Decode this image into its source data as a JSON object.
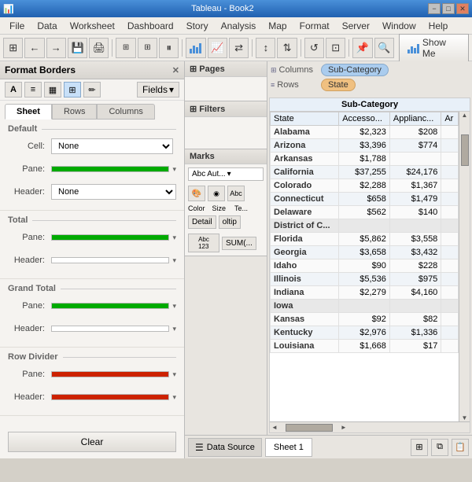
{
  "titleBar": {
    "title": "Tableau - Book2",
    "minimize": "−",
    "maximize": "□",
    "close": "✕"
  },
  "menuBar": {
    "items": [
      "File",
      "Data",
      "Worksheet",
      "Dashboard",
      "Story",
      "Analysis",
      "Map",
      "Format",
      "Server",
      "Window",
      "Help"
    ]
  },
  "toolbar": {
    "showMeLabel": "Show Me"
  },
  "formatPanel": {
    "title": "Format Borders",
    "fieldsLabel": "Fields",
    "tabs": [
      "Sheet",
      "Rows",
      "Columns"
    ],
    "activeTab": "Sheet",
    "sections": {
      "default": {
        "title": "Default",
        "rows": [
          {
            "label": "Cell:",
            "control": "dropdown",
            "value": "None"
          },
          {
            "label": "Pane:",
            "control": "colorline",
            "color": "green"
          },
          {
            "label": "Header:",
            "control": "dropdown",
            "value": "None"
          }
        ]
      },
      "total": {
        "title": "Total",
        "rows": [
          {
            "label": "Pane:",
            "control": "colorline",
            "color": "green"
          },
          {
            "label": "Header:",
            "control": "empty"
          }
        ]
      },
      "grandTotal": {
        "title": "Grand Total",
        "rows": [
          {
            "label": "Pane:",
            "control": "colorline",
            "color": "green"
          },
          {
            "label": "Header:",
            "control": "empty"
          }
        ]
      },
      "rowDivider": {
        "title": "Row Divider",
        "rows": [
          {
            "label": "Pane:",
            "control": "colorline",
            "color": "red"
          },
          {
            "label": "Header:",
            "control": "colorline",
            "color": "red"
          }
        ]
      }
    },
    "clearLabel": "Clear"
  },
  "shelf": {
    "columnsLabel": "Columns",
    "rowsLabel": "Rows",
    "columnsPill": "Sub-Category",
    "rowsPill": "State"
  },
  "dataPanel": {
    "pages": "Pages",
    "filters": "Filters",
    "marks": "Marks",
    "marksType": "Aut...",
    "detail": "Detail",
    "tooltip": "oltip",
    "sum": "SUM(..."
  },
  "vizHeader": "Sub-Category",
  "tableData": {
    "headers": [
      "State",
      "Accesso...",
      "Applianc...",
      "Ar"
    ],
    "rows": [
      {
        "state": "Alabama",
        "col1": "$2,323",
        "col2": "$208",
        "col3": "",
        "isGroup": false
      },
      {
        "state": "Arizona",
        "col1": "$3,396",
        "col2": "$774",
        "col3": "",
        "isGroup": false
      },
      {
        "state": "Arkansas",
        "col1": "$1,788",
        "col2": "",
        "col3": "",
        "isGroup": false
      },
      {
        "state": "California",
        "col1": "$37,255",
        "col2": "$24,176",
        "col3": "",
        "isGroup": false
      },
      {
        "state": "Colorado",
        "col1": "$2,288",
        "col2": "$1,367",
        "col3": "",
        "isGroup": false
      },
      {
        "state": "Connecticut",
        "col1": "$658",
        "col2": "$1,479",
        "col3": "",
        "isGroup": false
      },
      {
        "state": "Delaware",
        "col1": "$562",
        "col2": "$140",
        "col3": "",
        "isGroup": false
      },
      {
        "state": "District of C...",
        "col1": "",
        "col2": "",
        "col3": "",
        "isGroup": true
      },
      {
        "state": "Florida",
        "col1": "$5,862",
        "col2": "$3,558",
        "col3": "",
        "isGroup": false
      },
      {
        "state": "Georgia",
        "col1": "$3,658",
        "col2": "$3,432",
        "col3": "",
        "isGroup": false
      },
      {
        "state": "Idaho",
        "col1": "$90",
        "col2": "$228",
        "col3": "",
        "isGroup": false
      },
      {
        "state": "Illinois",
        "col1": "$5,536",
        "col2": "$975",
        "col3": "",
        "isGroup": false
      },
      {
        "state": "Indiana",
        "col1": "$2,279",
        "col2": "$4,160",
        "col3": "",
        "isGroup": false
      },
      {
        "state": "Iowa",
        "col1": "",
        "col2": "",
        "col3": "",
        "isGroup": true
      },
      {
        "state": "Kansas",
        "col1": "$92",
        "col2": "$82",
        "col3": "",
        "isGroup": false
      },
      {
        "state": "Kentucky",
        "col1": "$2,976",
        "col2": "$1,336",
        "col3": "",
        "isGroup": false
      },
      {
        "state": "Louisiana",
        "col1": "$1,668",
        "col2": "$17",
        "col3": "",
        "isGroup": false
      }
    ]
  },
  "bottomBar": {
    "dataSourceLabel": "Data Source",
    "sheetLabel": "Sheet 1"
  }
}
